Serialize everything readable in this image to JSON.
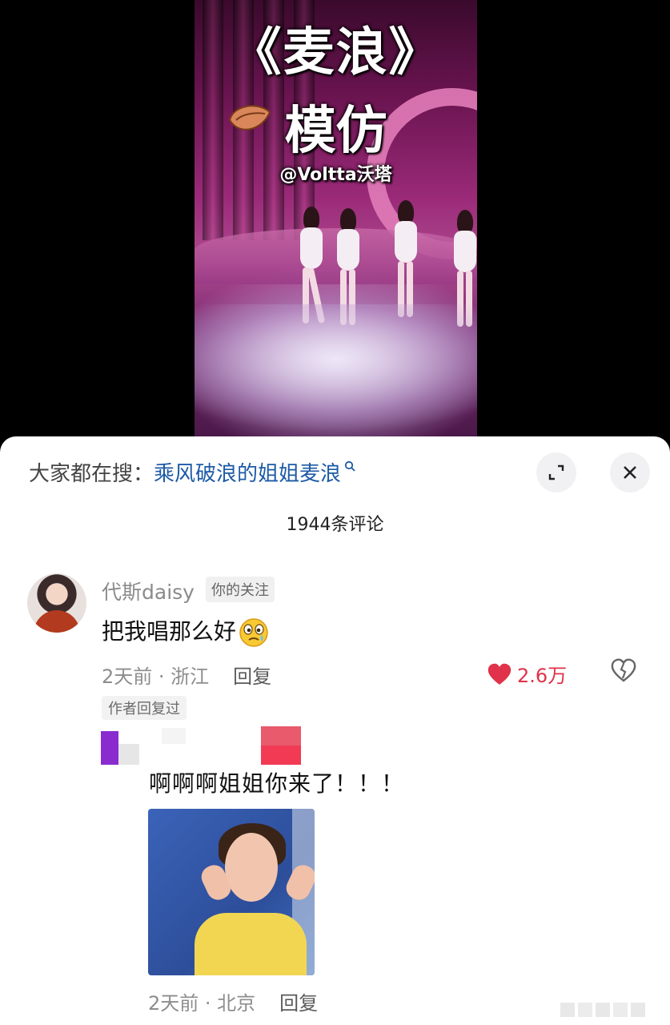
{
  "video": {
    "title": "《麦浪》",
    "subtitle": "模仿",
    "credit": "@Voltta沃塔"
  },
  "sheet": {
    "search_prefix": "大家都在搜：",
    "search_term": "乘风破浪的姐姐麦浪",
    "comment_count": "1944条评论",
    "comment": {
      "username": "代斯daisy",
      "follow_badge": "你的关注",
      "text": "把我唱那么好",
      "time": "2天前",
      "location": "浙江",
      "reply_label": "回复",
      "likes": "2.6万",
      "author_tag": "作者回复过"
    },
    "reply": {
      "text": "啊啊啊姐姐你来了！！！",
      "time": "2天前",
      "location": "北京",
      "reply_label": "回复"
    }
  },
  "colors": {
    "link": "#1d5aa6",
    "like": "#e0324a",
    "meta": "#8d8d8d"
  },
  "icons": [
    "peach-icon",
    "search-icon",
    "expand-icon",
    "close-icon",
    "heart-icon",
    "broken-heart-icon",
    "emoji-icon"
  ]
}
